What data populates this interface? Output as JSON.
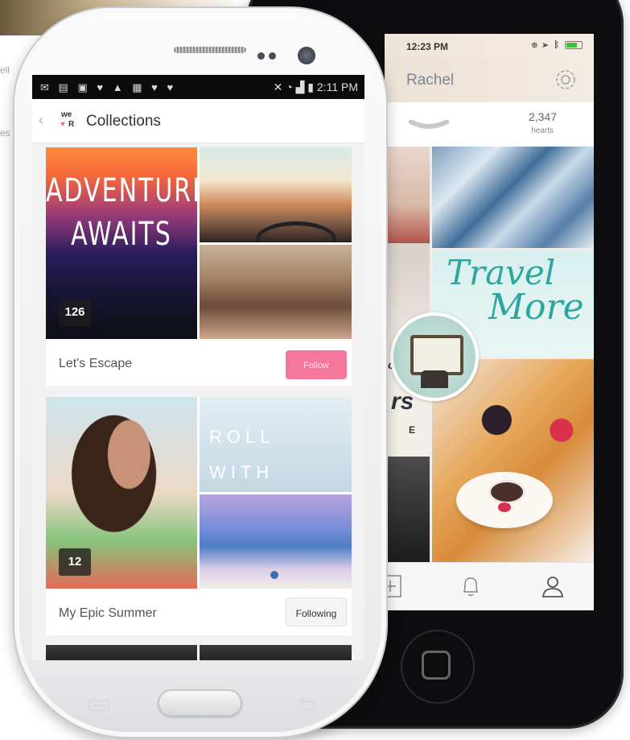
{
  "background": {
    "fragment_top": "ell",
    "fragment_mid": "es"
  },
  "iphone": {
    "status": {
      "time": "12:23 PM"
    },
    "profile": {
      "name": "Rachel"
    },
    "stats": {
      "hearts_count": "2,347",
      "hearts_label": "hearts"
    },
    "tiles": {
      "travel_line1": "Travel",
      "travel_line2": "More",
      "left_word_top": "o.",
      "left_word_mid": "rs",
      "left_word_bot": "E"
    },
    "tabs": [
      "add-icon",
      "bell-icon",
      "user-icon"
    ]
  },
  "samsung": {
    "status": {
      "time": "2:11 PM"
    },
    "header": {
      "title": "Collections",
      "logo_top": "we",
      "logo_bottom": "R"
    },
    "collections": [
      {
        "name": "Let's Escape",
        "count": "126",
        "button": "Follow",
        "cover_text_line1": "ADVENTURE",
        "cover_text_line2": "AWAITS"
      },
      {
        "name": "My Epic Summer",
        "count": "12",
        "button": "Following",
        "side_text_line1": "ROLL",
        "side_text_line2": "WITH"
      }
    ]
  },
  "colors": {
    "accent_pink": "#f4789c",
    "teal_script": "#2ea5a0",
    "iphone_body": "#0d0d0f",
    "samsung_body": "#f4f4f5"
  }
}
